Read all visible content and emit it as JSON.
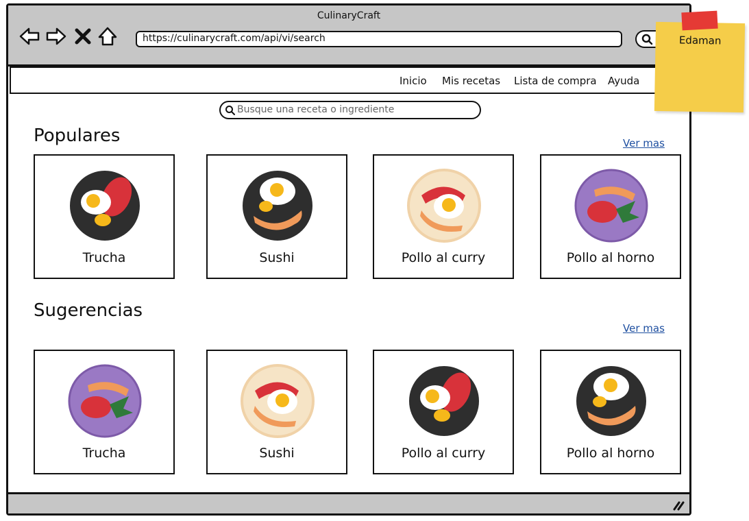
{
  "window": {
    "title": "CulinaryCraft"
  },
  "browser": {
    "url": "https://culinarycraft.com/api/vi/search",
    "icons": [
      "back-icon",
      "forward-icon",
      "close-icon",
      "home-icon",
      "search-icon"
    ]
  },
  "nav": {
    "items": [
      {
        "label": "Inicio"
      },
      {
        "label": "Mis recetas"
      },
      {
        "label": "Lista de compra"
      },
      {
        "label": "Ayuda"
      }
    ]
  },
  "search": {
    "placeholder": "Busque una receta o ingrediente"
  },
  "populares": {
    "title": "Populares",
    "link": "Ver mas",
    "cards": [
      {
        "label": "Trucha",
        "plate_color": "#2e2e2e"
      },
      {
        "label": "Sushi",
        "plate_color": "#2e2e2e"
      },
      {
        "label": "Pollo al curry",
        "plate_color": "#f6e4c6"
      },
      {
        "label": "Pollo al horno",
        "plate_color": "#9a79c4"
      }
    ]
  },
  "sugerencias": {
    "title": "Sugerencias",
    "link": "Ver mas",
    "cards": [
      {
        "label": "Trucha",
        "plate_color": "#9a79c4"
      },
      {
        "label": "Sushi",
        "plate_color": "#f6e4c6"
      },
      {
        "label": "Pollo al curry",
        "plate_color": "#2e2e2e"
      },
      {
        "label": "Pollo al horno",
        "plate_color": "#2e2e2e"
      }
    ]
  },
  "sticky_note": {
    "text": "Edaman",
    "color": "#f5cd49"
  },
  "colors": {
    "chrome": "#c6c6c6",
    "link": "#1e4fa0"
  }
}
